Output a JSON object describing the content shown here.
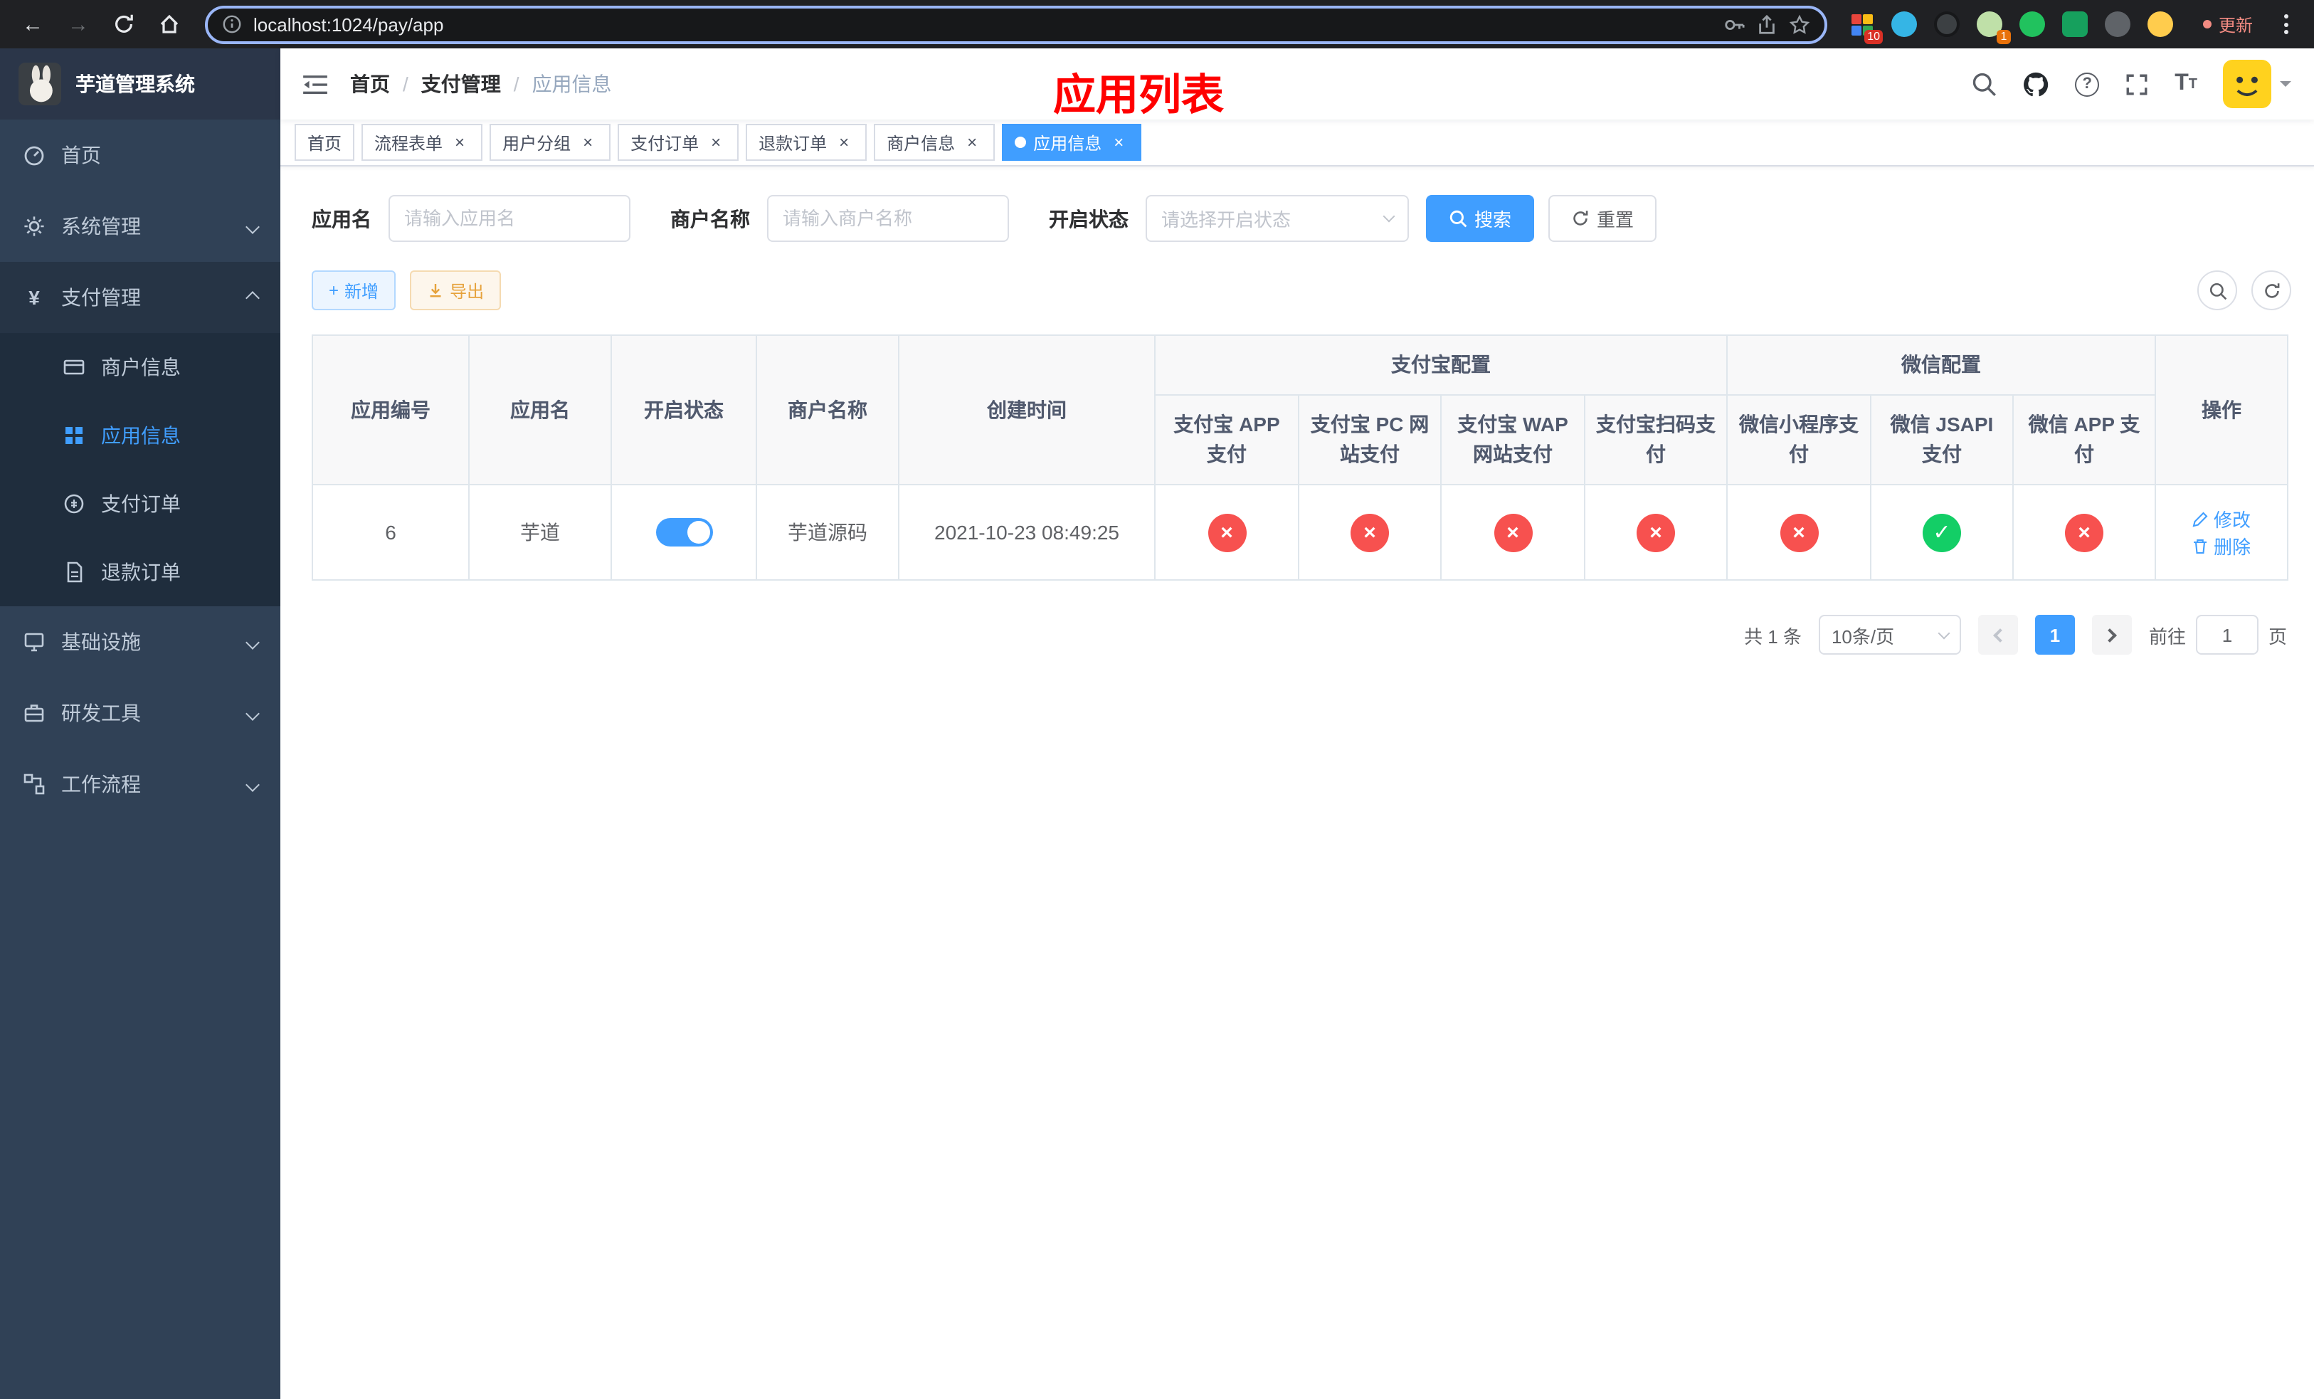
{
  "browser": {
    "url": "localhost:1024/pay/app",
    "update_label": "更新",
    "ext_badge_a": "10",
    "ext_badge_b": "1"
  },
  "sidebar": {
    "logo_title": "芋道管理系统",
    "items": [
      {
        "label": "首页"
      },
      {
        "label": "系统管理"
      },
      {
        "label": "支付管理",
        "children": [
          {
            "label": "商户信息"
          },
          {
            "label": "应用信息"
          },
          {
            "label": "支付订单"
          },
          {
            "label": "退款订单"
          }
        ]
      },
      {
        "label": "基础设施"
      },
      {
        "label": "研发工具"
      },
      {
        "label": "工作流程"
      }
    ]
  },
  "navbar": {
    "breadcrumb": [
      "首页",
      "支付管理",
      "应用信息"
    ],
    "separator": "/",
    "page_title": "应用列表"
  },
  "tags": [
    {
      "label": "首页"
    },
    {
      "label": "流程表单"
    },
    {
      "label": "用户分组"
    },
    {
      "label": "支付订单"
    },
    {
      "label": "退款订单"
    },
    {
      "label": "商户信息"
    },
    {
      "label": "应用信息"
    }
  ],
  "filters": {
    "app_name_label": "应用名",
    "app_name_placeholder": "请输入应用名",
    "merchant_label": "商户名称",
    "merchant_placeholder": "请输入商户名称",
    "status_label": "开启状态",
    "status_placeholder": "请选择开启状态",
    "search_button": "搜索",
    "reset_button": "重置"
  },
  "toolbar": {
    "add_button": "新增",
    "export_button": "导出"
  },
  "table": {
    "headers": {
      "app_id": "应用编号",
      "app_name": "应用名",
      "status": "开启状态",
      "merchant": "商户名称",
      "created": "创建时间",
      "alipay_group": "支付宝配置",
      "wechat_group": "微信配置",
      "alipay_app": "支付宝 APP 支付",
      "alipay_pc": "支付宝 PC 网站支付",
      "alipay_wap": "支付宝 WAP 网站支付",
      "alipay_qr": "支付宝扫码支付",
      "wx_mini": "微信小程序支付",
      "wx_jsapi": "微信 JSAPI 支付",
      "wx_app": "微信 APP 支付",
      "actions": "操作"
    },
    "rows": [
      {
        "app_id": "6",
        "app_name": "芋道",
        "enabled": true,
        "merchant": "芋道源码",
        "created": "2021-10-23 08:49:25",
        "alipay_app": false,
        "alipay_pc": false,
        "alipay_wap": false,
        "alipay_qr": false,
        "wx_mini": false,
        "wx_jsapi": true,
        "wx_app": false,
        "edit": "修改",
        "delete": "删除"
      }
    ]
  },
  "pagination": {
    "total": "共 1 条",
    "page_size": "10条/页",
    "current_page": "1",
    "goto_prefix": "前往",
    "goto_value": "1",
    "goto_suffix": "页"
  },
  "colors": {
    "primary": "#409eff",
    "success": "#13ce66",
    "danger": "#f7514f",
    "page_title": "#ff0000"
  }
}
